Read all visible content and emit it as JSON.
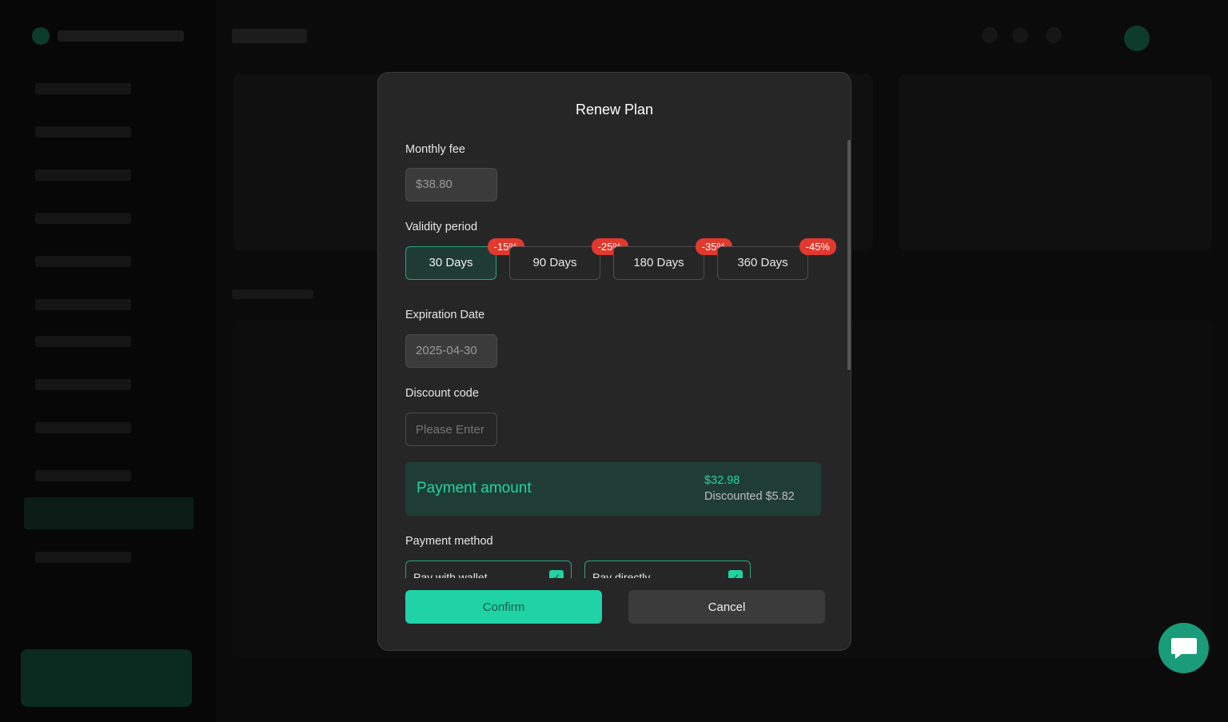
{
  "modal": {
    "title": "Renew Plan",
    "monthly_fee_label": "Monthly fee",
    "monthly_fee_value": "$38.80",
    "validity_label": "Validity period",
    "periods": [
      {
        "label": "30 Days",
        "badge": "-15%",
        "selected": true
      },
      {
        "label": "90 Days",
        "badge": "-25%",
        "selected": false
      },
      {
        "label": "180 Days",
        "badge": "-35%",
        "selected": false
      },
      {
        "label": "360 Days",
        "badge": "-45%",
        "selected": false
      }
    ],
    "expiration_label": "Expiration Date",
    "expiration_value": "2025-04-30",
    "discount_code_label": "Discount code",
    "discount_code_placeholder": "Please Enter",
    "payment_amount_label": "Payment amount",
    "payment_amount_value": "$32.98",
    "payment_discounted": "Discounted $5.82",
    "payment_method_label": "Payment method",
    "methods": [
      {
        "label": "Pay with wallet",
        "checked": true
      },
      {
        "label": "Pay directly",
        "checked": true
      }
    ],
    "confirm_label": "Confirm",
    "cancel_label": "Cancel"
  },
  "colors": {
    "accent": "#1fd3a6",
    "badge": "#e2392f",
    "modal_bg": "#262626"
  },
  "icons": {
    "chat": "chat-bubble-icon"
  }
}
